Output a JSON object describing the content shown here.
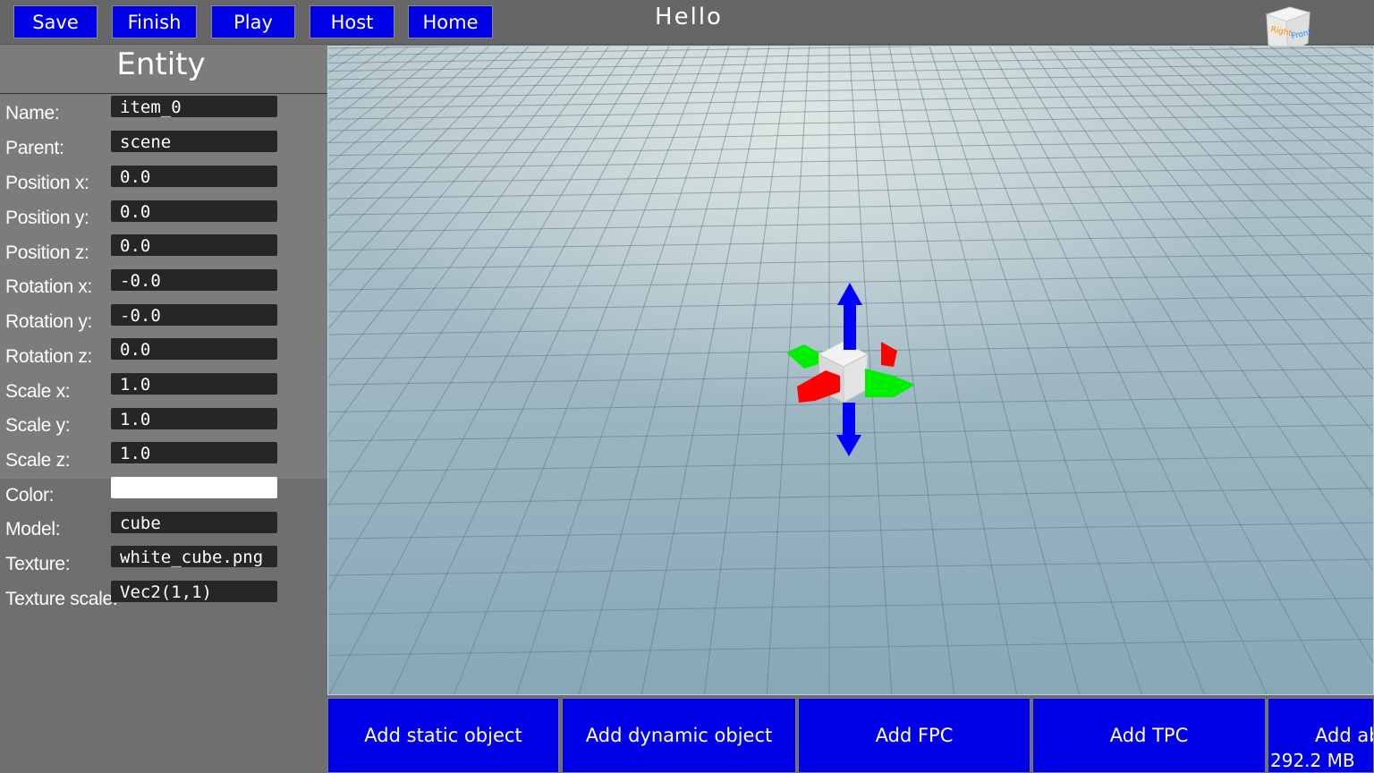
{
  "toolbar": {
    "buttons": [
      "Save",
      "Finish",
      "Play",
      "Host",
      "Home"
    ],
    "title": "Hello"
  },
  "navcube": {
    "right_label": "Right",
    "front_label": "Front"
  },
  "entity_panel": {
    "title": "Entity",
    "fields": [
      {
        "label": "Name:",
        "value": "item_0"
      },
      {
        "label": "Parent:",
        "value": "scene"
      },
      {
        "label": "Position x:",
        "value": "0.0"
      },
      {
        "label": "Position y:",
        "value": "0.0"
      },
      {
        "label": "Position z:",
        "value": "0.0"
      },
      {
        "label": "Rotation x:",
        "value": "-0.0"
      },
      {
        "label": "Rotation y:",
        "value": "-0.0"
      },
      {
        "label": "Rotation z:",
        "value": "0.0"
      },
      {
        "label": "Scale x:",
        "value": "1.0"
      },
      {
        "label": "Scale y:",
        "value": "1.0"
      },
      {
        "label": "Scale z:",
        "value": "1.0"
      },
      {
        "label": "Color:",
        "value": ""
      },
      {
        "label": "Model:",
        "value": "cube"
      },
      {
        "label": "Texture:",
        "value": "white_cube.png"
      },
      {
        "label": "Texture scale:",
        "value": "Vec2(1,1)"
      }
    ],
    "color_value": "#ffffff"
  },
  "bottom_buttons": [
    "Add static object",
    "Add dynamic object",
    "Add FPC",
    "Add TPC",
    "Add ab"
  ],
  "status": {
    "memory": "292.2 MB"
  },
  "colors": {
    "button": "#0000e6",
    "panel": "#7c7c7c",
    "gizmo_x": "#ff0000",
    "gizmo_y": "#0000ff",
    "gizmo_z": "#00ee00"
  }
}
